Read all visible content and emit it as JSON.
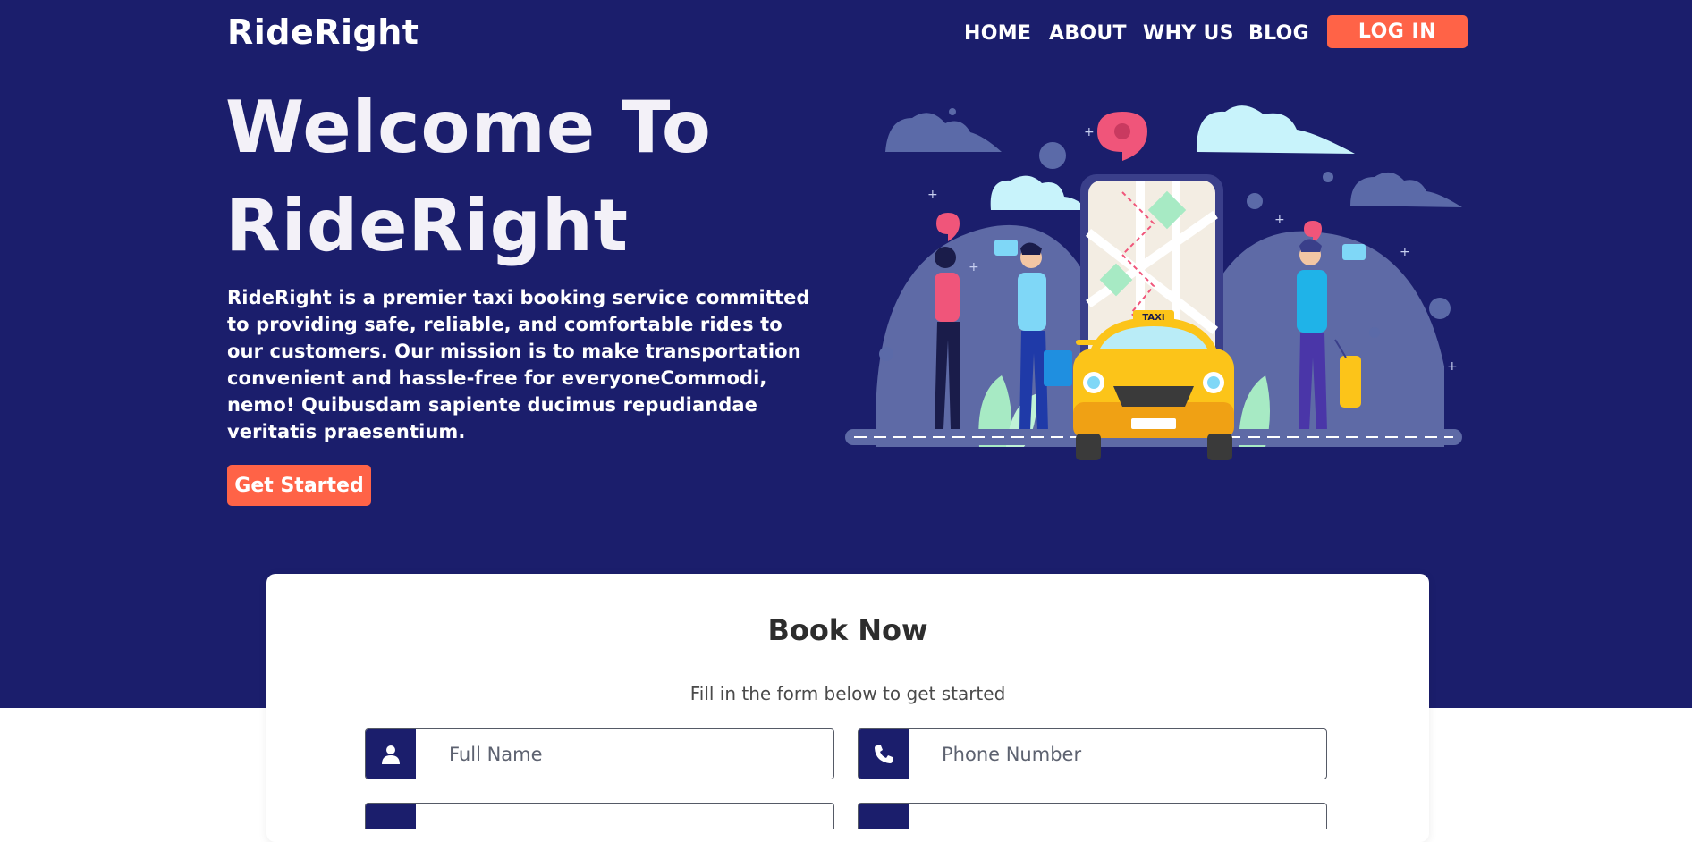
{
  "header": {
    "brand": "RideRight",
    "nav": [
      "HOME",
      "ABOUT",
      "WHY US",
      "BLOG"
    ],
    "login_label": "LOG IN"
  },
  "hero": {
    "title_line1": "Welcome To",
    "title_line2": "RideRight",
    "description": "RideRight is a premier taxi booking service committed to providing safe, reliable, and comfortable rides to our customers. Our mission is to make transportation convenient and hassle-free for everyoneCommodi, nemo! Quibusdam sapiente ducimus repudiandae veritatis praesentium.",
    "cta_label": "Get Started",
    "illustration_taxi_text": "TAXI"
  },
  "booking": {
    "title": "Book Now",
    "subtitle": "Fill in the form below to get started",
    "full_name_placeholder": "Full Name",
    "phone_placeholder": "Phone Number"
  },
  "icons": {
    "user": "user-icon",
    "phone": "phone-icon"
  },
  "colors": {
    "primary": "#1b1e6c",
    "accent": "#ff6347",
    "white": "#ffffff"
  }
}
